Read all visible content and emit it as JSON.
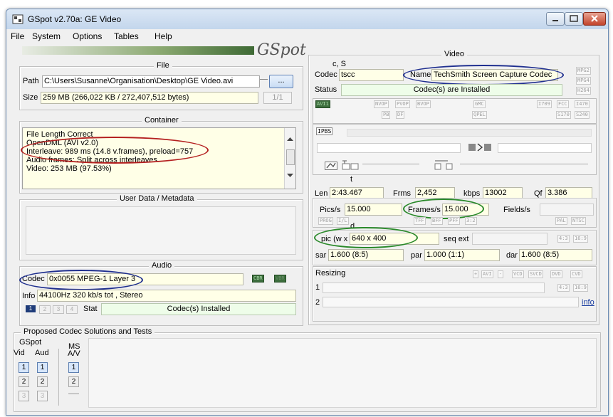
{
  "window": {
    "title": "GSpot v2.70a: GE Video"
  },
  "menu": [
    "File",
    "System",
    "Options",
    "Tables",
    "Help"
  ],
  "logo": "GSpot",
  "file_section": {
    "title": "File",
    "path_label": "Path",
    "path_value": "C:\\Users\\Susanne\\Organisation\\Desktop\\GE Video.avi",
    "browse_label": "...",
    "size_label": "Size",
    "size_value": "259 MB (266,022 KB / 272,407,512 bytes)",
    "page_counter": "1/1"
  },
  "container": {
    "title": "Container",
    "lines": [
      "File Length Correct",
      "OpenDML (AVI v2.0)",
      "Interleave: 989 ms (14.8 v.frames), preload=757",
      "Audio frames: Split across interleaves",
      "Video: 253 MB (97.53%)"
    ]
  },
  "user_data": {
    "title": "User Data / Metadata"
  },
  "audio": {
    "title": "Audio",
    "codec_label": "Codec",
    "codec_value": "0x0055 MPEG-1 Layer 3",
    "cbr": "CBR",
    "vbr": "VBR",
    "info_label": "Info",
    "info_value": "44100Hz  320 kb/s tot , Stereo",
    "stream_buttons": [
      "1",
      "2",
      "3",
      "4"
    ],
    "stat_label": "Stat",
    "stat_value": "Codec(s) Installed"
  },
  "proposed": {
    "title": "Proposed Codec Solutions and Tests",
    "gspot_label": "GSpot",
    "ms_label": "MS",
    "vid_label": "Vid",
    "aud_label": "Aud",
    "av_label": "A/V",
    "nums": [
      "1",
      "2",
      "3"
    ]
  },
  "video": {
    "title": "Video",
    "cs_label": "c, S",
    "codec_label": "Codec",
    "codec_value": "tscc",
    "name_label": "Name",
    "name_value": "TechSmith Screen Capture Codec",
    "status_label": "Status",
    "status_value": "Codec(s) are Installed",
    "mpg_tags": [
      "MPG2",
      "MPG4",
      "H264"
    ],
    "row1_tags": [
      "AVI1",
      "NVOP",
      "PVOP",
      "BVOP",
      "GMC",
      "I709",
      "FCC",
      "I470"
    ],
    "row2_tags": [
      "PB",
      "DF",
      "QPEL",
      "S170",
      "S240"
    ],
    "frame_types": [
      "I",
      "P",
      "B",
      "S"
    ],
    "t_label": "t",
    "len_label": "Len",
    "len_value": "2:43.467",
    "frms_label": "Frms",
    "frms_value": "2,452",
    "kbps_label": "kbps",
    "kbps_value": "13002",
    "qf_label": "Qf",
    "qf_value": "3.386",
    "pics_label": "Pics/s",
    "pics_value": "15.000",
    "frames_label": "Frames/s",
    "frames_value": "15.000",
    "fields_label": "Fields/s",
    "prog_tags": [
      "PROG",
      "I/L",
      "TFF",
      "BFF",
      "PFF",
      "3:2",
      "PAL",
      "NTSC"
    ],
    "d_label": "d",
    "pic_label": "pic (w x",
    "pic_value": "640 x 400",
    "seqext_label": "seq ext",
    "aspect_tags": [
      "4:3",
      "16:9"
    ],
    "sar_label": "sar",
    "sar_value": "1.600 (8:5)",
    "par_label": "par",
    "par_value": "1.000 (1:1)",
    "dar_label": "dar",
    "dar_value": "1.600 (8:5)",
    "resizing_label": "Resizing",
    "resize_tags": [
      "+",
      "AVI",
      "-",
      "VCD",
      "SVCD",
      "DVD",
      "CVD"
    ],
    "row1_num": "1",
    "row2_num": "2",
    "info_link": "info"
  },
  "colors": {
    "red_oval": "#b42020",
    "blue_oval": "#1f2f8f",
    "green_oval": "#2a8a2a"
  }
}
